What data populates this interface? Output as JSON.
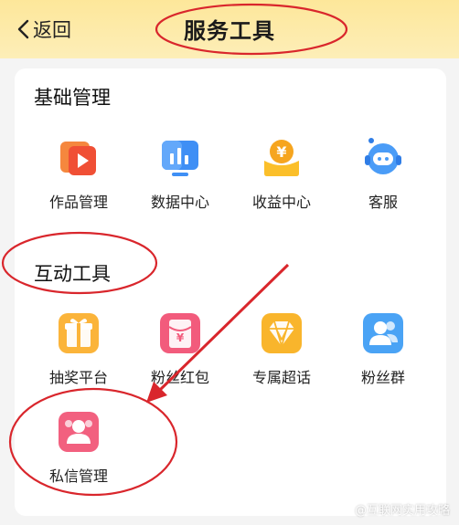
{
  "header": {
    "back_label": "返回",
    "title": "服务工具"
  },
  "sections": [
    {
      "title": "基础管理",
      "items": [
        {
          "label": "作品管理",
          "icon": "video-play-icon"
        },
        {
          "label": "数据中心",
          "icon": "bar-chart-icon"
        },
        {
          "label": "收益中心",
          "icon": "yen-coin-icon"
        },
        {
          "label": "客服",
          "icon": "headset-icon"
        }
      ]
    },
    {
      "title": "互动工具",
      "items": [
        {
          "label": "抽奖平台",
          "icon": "gift-icon"
        },
        {
          "label": "粉丝红包",
          "icon": "red-envelope-icon"
        },
        {
          "label": "专属超话",
          "icon": "diamond-icon"
        },
        {
          "label": "粉丝群",
          "icon": "group-icon"
        },
        {
          "label": "私信管理",
          "icon": "private-message-icon"
        }
      ]
    }
  ],
  "watermark": "@互联网实用攻略",
  "colors": {
    "header_bg": "#fde79a",
    "annotation_red": "#d9262c"
  }
}
